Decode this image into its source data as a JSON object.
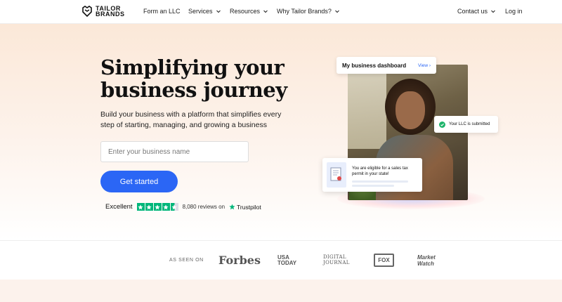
{
  "brand": {
    "line1": "TAILOR",
    "line2": "BRANDS"
  },
  "nav": {
    "form_llc": "Form an LLC",
    "services": "Services",
    "resources": "Resources",
    "why": "Why Tailor Brands?",
    "contact": "Contact us",
    "login": "Log in"
  },
  "hero": {
    "headline": "Simplifying your business journey",
    "subtitle": "Build your business with a platform that simplifies every step of starting, managing, and growing a business",
    "input_placeholder": "Enter your business name",
    "cta": "Get started"
  },
  "rating": {
    "label": "Excellent",
    "reviews": "8,080 reviews on",
    "source": "Trustpilot",
    "stars": 4.5
  },
  "dashboard": {
    "title": "My business dashboard",
    "view": "View ›",
    "llc_status": "Your LLC is submitted",
    "permit_text": "You are eligible for a sales tax permit in your state!"
  },
  "press": {
    "label": "AS SEEN ON",
    "logos": {
      "forbes": "Forbes",
      "usa1": "USA",
      "usa2": "TODAY",
      "dj1": "DIGITAL",
      "dj2": "JOURNAL",
      "fox": "FOX",
      "mw1": "Market",
      "mw2": "Watch"
    }
  },
  "colors": {
    "accent": "#2b66f5",
    "trustpilot": "#00b67a",
    "hero_bg": "#fbe8d8"
  }
}
